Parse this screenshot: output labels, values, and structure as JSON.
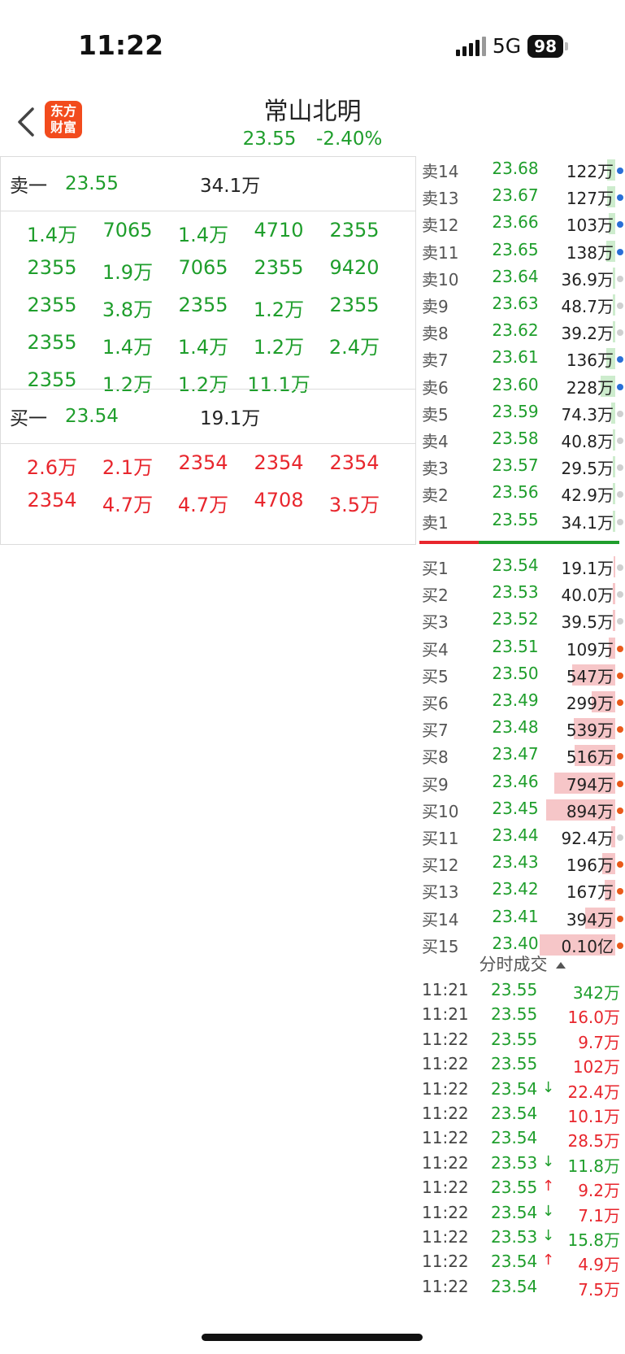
{
  "status_bar": {
    "time": "11:22",
    "network": "5G",
    "battery": "98"
  },
  "header": {
    "stock_name": "常山北明",
    "price": "23.55",
    "change": "-2.40%",
    "logo_line1": "东方",
    "logo_line2": "财富"
  },
  "ask1": {
    "label": "卖一",
    "price": "23.55",
    "volume": "34.1万"
  },
  "ask_queue": [
    "1.4万",
    "7065",
    "1.4万",
    "4710",
    "2355",
    "2355",
    "1.9万",
    "7065",
    "2355",
    "9420",
    "2355",
    "3.8万",
    "2355",
    "1.2万",
    "2355",
    "2355",
    "1.4万",
    "1.4万",
    "1.2万",
    "2.4万",
    "2355",
    "1.2万",
    "1.2万",
    "11.1万"
  ],
  "bid1": {
    "label": "买一",
    "price": "23.54",
    "volume": "19.1万"
  },
  "bid_queue": [
    "2.6万",
    "2.1万",
    "2354",
    "2354",
    "2354",
    "2354",
    "4.7万",
    "4.7万",
    "4708",
    "3.5万"
  ],
  "order_book": {
    "asks": [
      {
        "level": "卖14",
        "price": "23.68",
        "volume": "122万",
        "bar": 0.06,
        "dot": "blue"
      },
      {
        "level": "卖13",
        "price": "23.67",
        "volume": "127万",
        "bar": 0.06,
        "dot": "blue"
      },
      {
        "level": "卖12",
        "price": "23.66",
        "volume": "103万",
        "bar": 0.05,
        "dot": "blue"
      },
      {
        "level": "卖11",
        "price": "23.65",
        "volume": "138万",
        "bar": 0.07,
        "dot": "blue"
      },
      {
        "level": "卖10",
        "price": "23.64",
        "volume": "36.9万",
        "bar": 0.02,
        "dot": "gray"
      },
      {
        "level": "卖9",
        "price": "23.63",
        "volume": "48.7万",
        "bar": 0.02,
        "dot": "gray"
      },
      {
        "level": "卖8",
        "price": "23.62",
        "volume": "39.2万",
        "bar": 0.02,
        "dot": "gray"
      },
      {
        "level": "卖7",
        "price": "23.61",
        "volume": "136万",
        "bar": 0.07,
        "dot": "blue"
      },
      {
        "level": "卖6",
        "price": "23.60",
        "volume": "228万",
        "bar": 0.11,
        "dot": "blue"
      },
      {
        "level": "卖5",
        "price": "23.59",
        "volume": "74.3万",
        "bar": 0.03,
        "dot": "gray"
      },
      {
        "level": "卖4",
        "price": "23.58",
        "volume": "40.8万",
        "bar": 0.02,
        "dot": "gray"
      },
      {
        "level": "卖3",
        "price": "23.57",
        "volume": "29.5万",
        "bar": 0.02,
        "dot": "gray"
      },
      {
        "level": "卖2",
        "price": "23.56",
        "volume": "42.9万",
        "bar": 0.02,
        "dot": "gray"
      },
      {
        "level": "卖1",
        "price": "23.55",
        "volume": "34.1万",
        "bar": 0.02,
        "dot": "gray"
      }
    ],
    "bids": [
      {
        "level": "买1",
        "price": "23.54",
        "volume": "19.1万",
        "bar": 0.01,
        "dot": "gray"
      },
      {
        "level": "买2",
        "price": "23.53",
        "volume": "40.0万",
        "bar": 0.02,
        "dot": "gray"
      },
      {
        "level": "买3",
        "price": "23.52",
        "volume": "39.5万",
        "bar": 0.02,
        "dot": "gray"
      },
      {
        "level": "买4",
        "price": "23.51",
        "volume": "109万",
        "bar": 0.05,
        "dot": "orange"
      },
      {
        "level": "买5",
        "price": "23.50",
        "volume": "547万",
        "bar": 0.33,
        "dot": "orange"
      },
      {
        "level": "买6",
        "price": "23.49",
        "volume": "299万",
        "bar": 0.18,
        "dot": "orange"
      },
      {
        "level": "买7",
        "price": "23.48",
        "volume": "539万",
        "bar": 0.32,
        "dot": "orange"
      },
      {
        "level": "买8",
        "price": "23.47",
        "volume": "516万",
        "bar": 0.31,
        "dot": "orange"
      },
      {
        "level": "买9",
        "price": "23.46",
        "volume": "794万",
        "bar": 0.47,
        "dot": "orange"
      },
      {
        "level": "买10",
        "price": "23.45",
        "volume": "894万",
        "bar": 0.53,
        "dot": "orange"
      },
      {
        "level": "买11",
        "price": "23.44",
        "volume": "92.4万",
        "bar": 0.03,
        "dot": "gray"
      },
      {
        "level": "买12",
        "price": "23.43",
        "volume": "196万",
        "bar": 0.1,
        "dot": "orange"
      },
      {
        "level": "买13",
        "price": "23.42",
        "volume": "167万",
        "bar": 0.08,
        "dot": "orange"
      },
      {
        "level": "买14",
        "price": "23.41",
        "volume": "394万",
        "bar": 0.23,
        "dot": "orange"
      },
      {
        "level": "买15",
        "price": "23.40",
        "volume": "0.10亿",
        "bar": 0.58,
        "dot": "orange"
      }
    ]
  },
  "ticks_title": "分时成交",
  "ticks": [
    {
      "time": "11:21",
      "price": "23.55",
      "arrow": "",
      "volume": "342万",
      "color": "green"
    },
    {
      "time": "11:21",
      "price": "23.55",
      "arrow": "",
      "volume": "16.0万",
      "color": "red"
    },
    {
      "time": "11:22",
      "price": "23.55",
      "arrow": "",
      "volume": "9.7万",
      "color": "red"
    },
    {
      "time": "11:22",
      "price": "23.55",
      "arrow": "",
      "volume": "102万",
      "color": "red"
    },
    {
      "time": "11:22",
      "price": "23.54",
      "arrow": "↓",
      "volume": "22.4万",
      "color": "red"
    },
    {
      "time": "11:22",
      "price": "23.54",
      "arrow": "",
      "volume": "10.1万",
      "color": "red"
    },
    {
      "time": "11:22",
      "price": "23.54",
      "arrow": "",
      "volume": "28.5万",
      "color": "red"
    },
    {
      "time": "11:22",
      "price": "23.53",
      "arrow": "↓",
      "volume": "11.8万",
      "color": "green"
    },
    {
      "time": "11:22",
      "price": "23.55",
      "arrow": "↑",
      "volume": "9.2万",
      "color": "red"
    },
    {
      "time": "11:22",
      "price": "23.54",
      "arrow": "↓",
      "volume": "7.1万",
      "color": "red"
    },
    {
      "time": "11:22",
      "price": "23.53",
      "arrow": "↓",
      "volume": "15.8万",
      "color": "green"
    },
    {
      "time": "11:22",
      "price": "23.54",
      "arrow": "↑",
      "volume": "4.9万",
      "color": "red"
    },
    {
      "time": "11:22",
      "price": "23.54",
      "arrow": "",
      "volume": "7.5万",
      "color": "red"
    }
  ],
  "colors": {
    "green": "#1f9e2c",
    "red": "#e8262d",
    "blue": "#2a6fd6",
    "orange": "#e85a1a",
    "gray": "#cfcfcf",
    "ask_bar": "#cdeccd",
    "bid_bar": "#f6c6c8"
  }
}
